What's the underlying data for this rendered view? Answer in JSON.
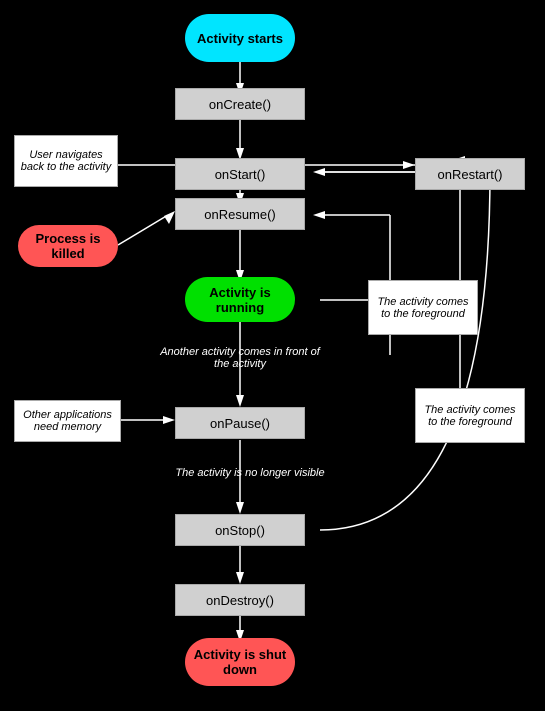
{
  "nodes": {
    "activity_starts": {
      "label": "Activity\nstarts"
    },
    "oncreate": {
      "label": "onCreate()"
    },
    "onstart": {
      "label": "onStart()"
    },
    "onrestart": {
      "label": "onRestart()"
    },
    "onresume": {
      "label": "onResume()"
    },
    "activity_running": {
      "label": "Activity is\nrunning"
    },
    "onpause": {
      "label": "onPause()"
    },
    "onstop": {
      "label": "onStop()"
    },
    "ondestroy": {
      "label": "onDestroy()"
    },
    "activity_shutdown": {
      "label": "Activity is\nshut down"
    },
    "process_killed": {
      "label": "Process is\nkilled"
    },
    "user_navigates": {
      "label": "User navigates\nback to the\nactivity"
    },
    "another_activity": {
      "label": "Another activity comes\nin front of the activity"
    },
    "activity_foreground1": {
      "label": "The activity\ncomes to the\nforeground"
    },
    "activity_foreground2": {
      "label": "The activity\ncomes to the\nforeground"
    },
    "other_apps": {
      "label": "Other applications\nneed memory"
    },
    "no_longer_visible": {
      "label": "The activity is no longer visible"
    }
  }
}
